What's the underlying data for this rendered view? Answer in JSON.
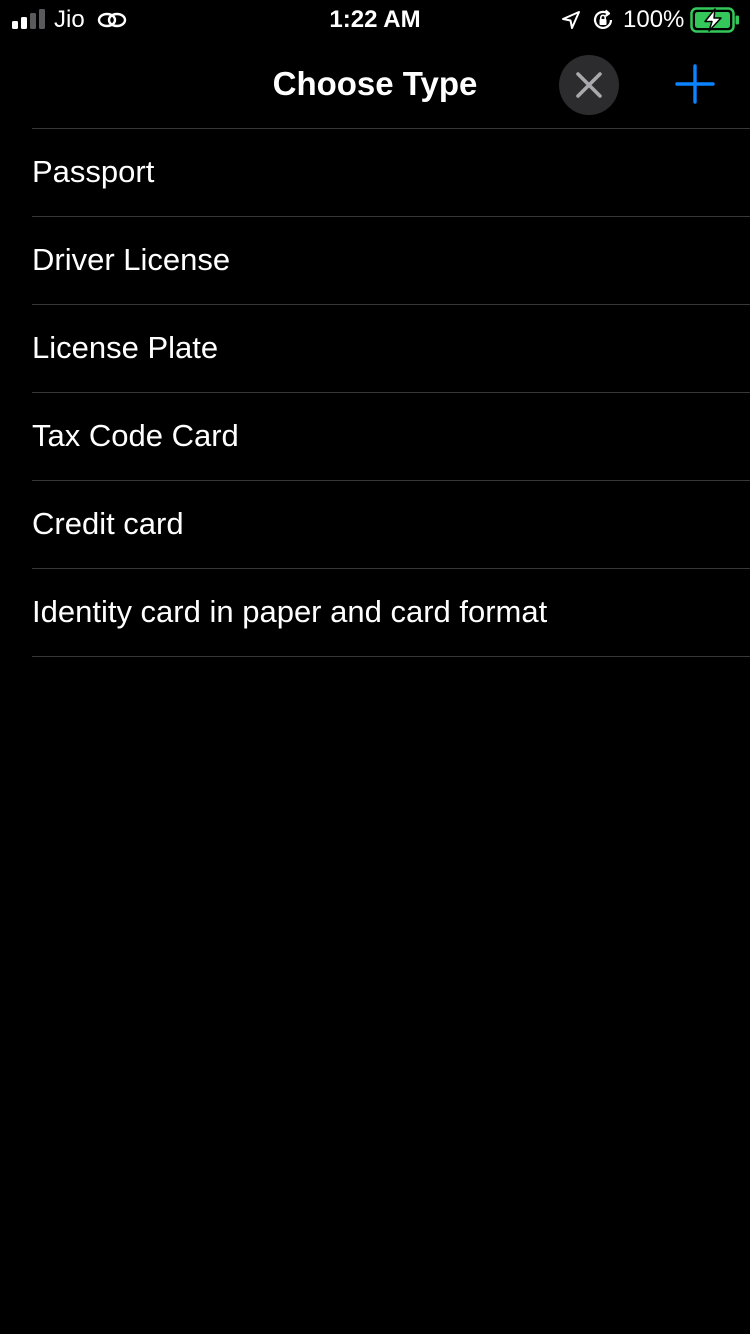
{
  "status_bar": {
    "carrier": "Jio",
    "time": "1:22 AM",
    "battery_percent": "100%",
    "signal_icon": "signal-bars-icon",
    "link_icon": "personal-hotspot-link-icon",
    "location_icon": "location-arrow-icon",
    "rotation_lock_icon": "rotation-lock-icon",
    "battery_icon": "battery-charging-icon",
    "battery_color": "#34c759"
  },
  "nav": {
    "title": "Choose Type",
    "close_icon": "close-icon",
    "add_icon": "plus-icon",
    "accent_color": "#0a84ff"
  },
  "types": [
    {
      "label": "Passport"
    },
    {
      "label": "Driver License"
    },
    {
      "label": "License Plate"
    },
    {
      "label": "Tax Code Card"
    },
    {
      "label": "Credit card"
    },
    {
      "label": "Identity card in paper and card format"
    }
  ]
}
